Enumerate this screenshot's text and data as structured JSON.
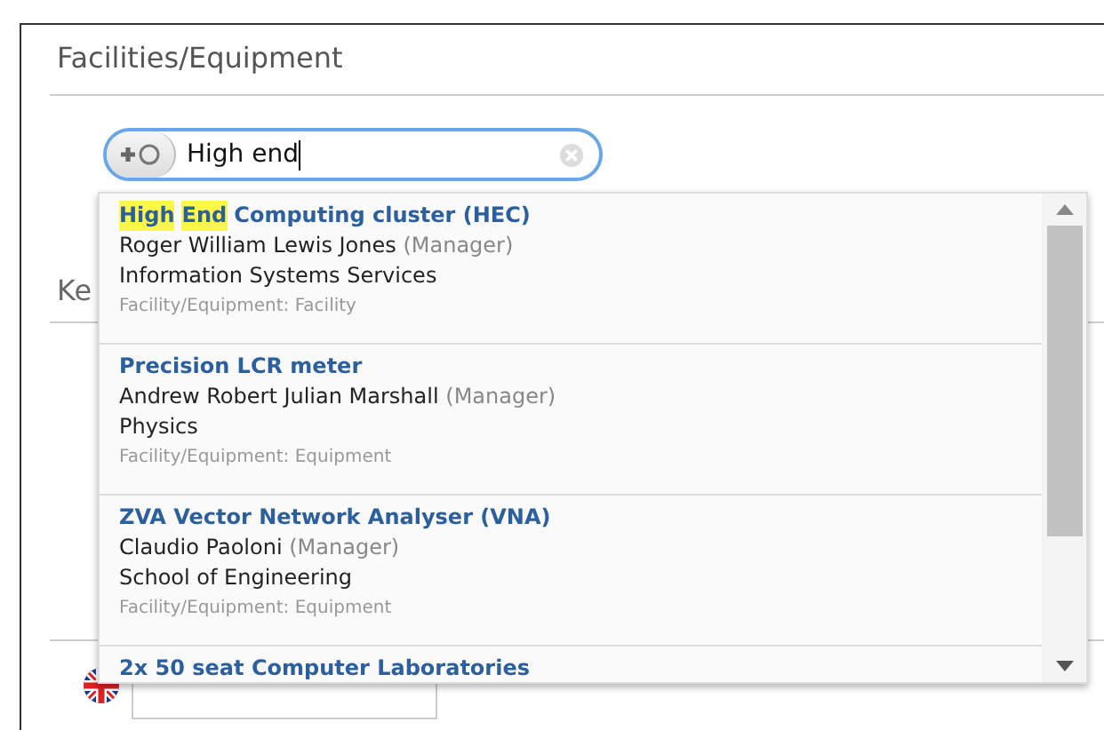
{
  "section": {
    "title": "Facilities/Equipment"
  },
  "search": {
    "value": "High end"
  },
  "hidden_label": "Ke",
  "results": [
    {
      "title_parts": [
        {
          "text": "High",
          "highlighted": true
        },
        {
          "text": "End",
          "highlighted": true
        },
        {
          "text": "Computing cluster (HEC)",
          "highlighted": false
        }
      ],
      "person": "Roger William Lewis Jones",
      "role": "(Manager)",
      "department": "Information Systems Services",
      "type": "Facility/Equipment: Facility"
    },
    {
      "title_parts": [
        {
          "text": "Precision LCR meter",
          "highlighted": false
        }
      ],
      "person": "Andrew Robert Julian Marshall",
      "role": "(Manager)",
      "department": "Physics",
      "type": "Facility/Equipment: Equipment"
    },
    {
      "title_parts": [
        {
          "text": "ZVA Vector Network Analyser (VNA)",
          "highlighted": false
        }
      ],
      "person": "Claudio Paoloni",
      "role": "(Manager)",
      "department": "School of Engineering",
      "type": "Facility/Equipment: Equipment"
    },
    {
      "title_parts": [
        {
          "text": "2x 50 seat Computer Laboratories",
          "highlighted": false
        }
      ]
    }
  ]
}
